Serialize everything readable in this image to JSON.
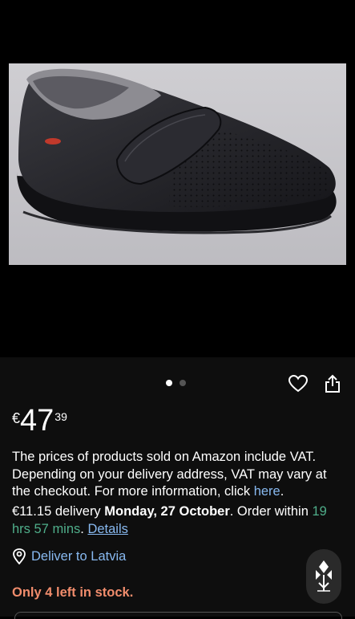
{
  "carousel": {
    "dot_count": 2,
    "active_index": 0
  },
  "icons": {
    "wishlist": "heart-outline-icon",
    "share": "share-icon",
    "location": "location-pin-icon",
    "assistant": "assistant-icon"
  },
  "price": {
    "currency": "€",
    "whole": "47",
    "fraction": "39"
  },
  "vat_notice": {
    "text": "The prices of products sold on Amazon include VAT. Depending on your delivery address, VAT may vary at the checkout. For more information, click ",
    "link": "here",
    "end": "."
  },
  "delivery": {
    "cost": "€11.15 delivery ",
    "date": "Monday, 27 October",
    "order_within_prefix": ". Order within ",
    "countdown": "19 hrs 57 mins",
    "sep": ". ",
    "details_link": "Details"
  },
  "deliver_to": "Deliver to Latvia",
  "stock": "Only 4 left in stock.",
  "colors": {
    "background": "#000000",
    "link": "#88b9f0",
    "countdown": "#4fae8a",
    "stock_warning": "#f08c6c"
  }
}
